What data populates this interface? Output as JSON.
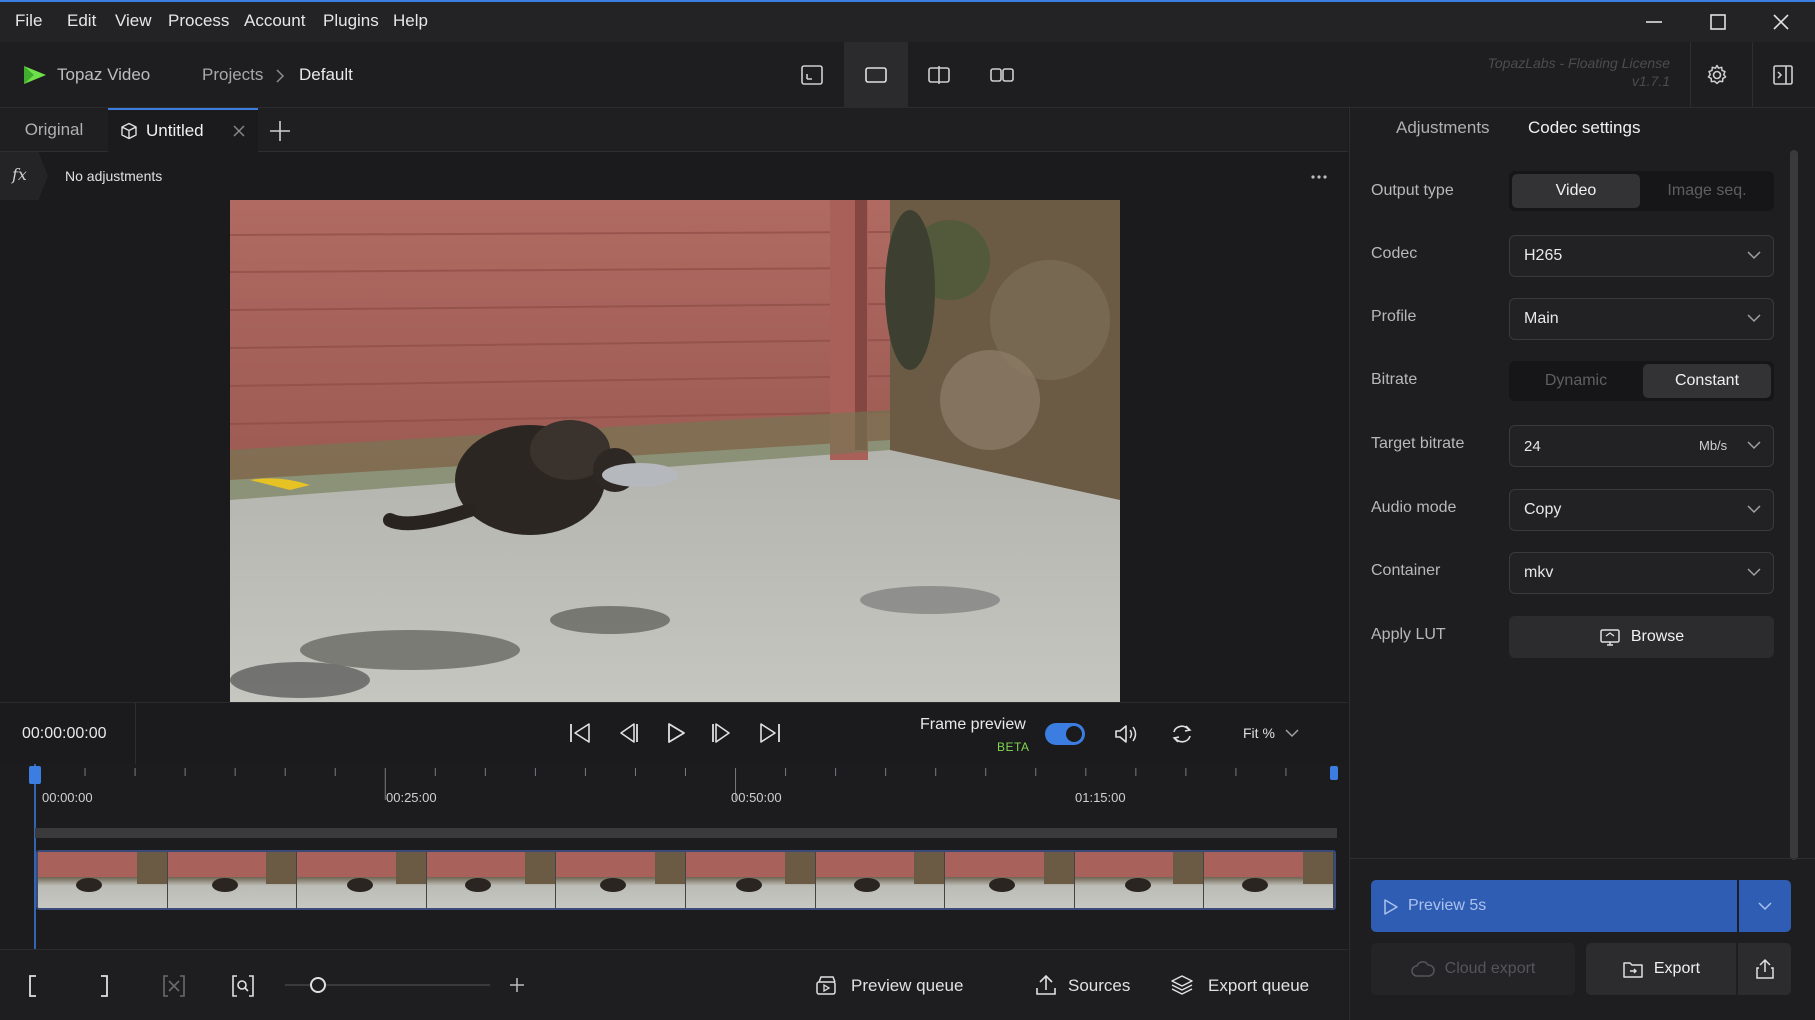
{
  "menu": [
    "File",
    "Edit",
    "View",
    "Process",
    "Account",
    "Plugins",
    "Help"
  ],
  "header": {
    "app_name": "Topaz Video",
    "breadcrumb_projects": "Projects",
    "breadcrumb_current": "Default",
    "license_line1": "TopazLabs - Floating License",
    "license_line2": "v1.7.1"
  },
  "tabs": {
    "original": "Original",
    "untitled": "Untitled"
  },
  "adjustments": {
    "label": "No adjustments"
  },
  "transport": {
    "timecode": "00:00:00:00",
    "frame_preview": "Frame preview",
    "beta": "BETA",
    "frame_preview_on": true,
    "fit": "Fit %"
  },
  "timeline": {
    "markers": [
      "00:00:00",
      "00:25:00",
      "00:50:00",
      "01:15:00"
    ]
  },
  "bottombar": {
    "preview_queue": "Preview queue",
    "sources": "Sources",
    "export_queue": "Export queue"
  },
  "panel": {
    "tab_adjustments": "Adjustments",
    "tab_codec": "Codec settings",
    "output_type_label": "Output type",
    "output_type_video": "Video",
    "output_type_imgseq": "Image seq.",
    "codec_label": "Codec",
    "codec_value": "H265",
    "profile_label": "Profile",
    "profile_value": "Main",
    "bitrate_label": "Bitrate",
    "bitrate_dynamic": "Dynamic",
    "bitrate_constant": "Constant",
    "target_bitrate_label": "Target bitrate",
    "target_bitrate_value": "24",
    "target_bitrate_unit": "Mb/s",
    "audio_mode_label": "Audio mode",
    "audio_mode_value": "Copy",
    "container_label": "Container",
    "container_value": "mkv",
    "lut_label": "Apply LUT",
    "browse": "Browse",
    "preview": "Preview 5s",
    "cloud_export": "Cloud export",
    "export": "Export"
  },
  "colors": {
    "accent": "#3b7de0",
    "brand_green": "#6ee14a",
    "preview_button": "#2f5db3"
  }
}
